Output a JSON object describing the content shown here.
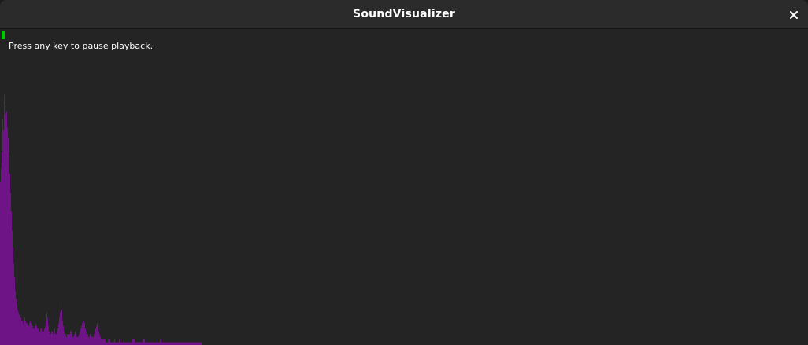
{
  "window": {
    "title": "SoundVisualizer",
    "close_icon": "close-icon"
  },
  "playback": {
    "progress": 0.06,
    "progress_color": "#00c800",
    "hint": "Press any key to pause playback."
  },
  "chart_data": {
    "type": "bar",
    "title": "",
    "xlabel": "",
    "ylabel": "",
    "ylim": [
      0,
      1
    ],
    "color": "#6e1487",
    "grid": false,
    "values": [
      0.6,
      0.65,
      0.71,
      0.83,
      0.79,
      0.92,
      0.85,
      0.88,
      0.86,
      0.8,
      0.76,
      0.7,
      0.63,
      0.56,
      0.49,
      0.42,
      0.36,
      0.3,
      0.25,
      0.2,
      0.17,
      0.15,
      0.13,
      0.12,
      0.11,
      0.1,
      0.1,
      0.09,
      0.09,
      0.08,
      0.09,
      0.1,
      0.09,
      0.08,
      0.08,
      0.07,
      0.07,
      0.08,
      0.09,
      0.08,
      0.07,
      0.07,
      0.06,
      0.06,
      0.07,
      0.08,
      0.07,
      0.06,
      0.06,
      0.05,
      0.05,
      0.06,
      0.06,
      0.05,
      0.05,
      0.05,
      0.06,
      0.07,
      0.09,
      0.12,
      0.1,
      0.07,
      0.05,
      0.04,
      0.04,
      0.05,
      0.05,
      0.04,
      0.05,
      0.06,
      0.04,
      0.04,
      0.05,
      0.06,
      0.08,
      0.1,
      0.12,
      0.16,
      0.13,
      0.09,
      0.07,
      0.05,
      0.04,
      0.04,
      0.03,
      0.04,
      0.04,
      0.03,
      0.04,
      0.05,
      0.05,
      0.04,
      0.03,
      0.03,
      0.04,
      0.05,
      0.04,
      0.03,
      0.03,
      0.03,
      0.04,
      0.05,
      0.06,
      0.07,
      0.08,
      0.07,
      0.09,
      0.08,
      0.06,
      0.05,
      0.04,
      0.04,
      0.03,
      0.03,
      0.04,
      0.04,
      0.03,
      0.03,
      0.03,
      0.04,
      0.05,
      0.06,
      0.07,
      0.08,
      0.06,
      0.05,
      0.04,
      0.03,
      0.02,
      0.02,
      0.02,
      0.02,
      0.02,
      0.02,
      0.01,
      0.01,
      0.01,
      0.02,
      0.02,
      0.02,
      0.01,
      0.01,
      0.01,
      0.01,
      0.01,
      0.02,
      0.01,
      0.01,
      0.01,
      0.01,
      0.01,
      0.02,
      0.02,
      0.01,
      0.01,
      0.01,
      0.01,
      0.02,
      0.01,
      0.01,
      0.01,
      0.01,
      0.01,
      0.01,
      0.01,
      0.01,
      0.01,
      0.01,
      0.02,
      0.02,
      0.02,
      0.01,
      0.01,
      0.01,
      0.01,
      0.01,
      0.01,
      0.01,
      0.01,
      0.01,
      0.01,
      0.02,
      0.02,
      0.02,
      0.01,
      0.01,
      0.01,
      0.01,
      0.01,
      0.01,
      0.01,
      0.01,
      0.01,
      0.01,
      0.01,
      0.01,
      0.01,
      0.01,
      0.01,
      0.01,
      0.01,
      0.01,
      0.01,
      0.02,
      0.02,
      0.01,
      0.01,
      0.01,
      0.01,
      0.01,
      0.01,
      0.01,
      0.01,
      0.01,
      0.01,
      0.01,
      0.01,
      0.01,
      0.01,
      0.01,
      0.01,
      0.01,
      0.01,
      0.01,
      0.01,
      0.01,
      0.01,
      0.01,
      0.01,
      0.01,
      0.01,
      0.01,
      0.01,
      0.01,
      0.01,
      0.01,
      0.01,
      0.01,
      0.01,
      0.01,
      0.01,
      0.01,
      0.01,
      0.01,
      0.01,
      0.01,
      0.01,
      0.01,
      0.01,
      0.01,
      0.01,
      0.01,
      0.01,
      0.01,
      0.01,
      0.01
    ]
  }
}
